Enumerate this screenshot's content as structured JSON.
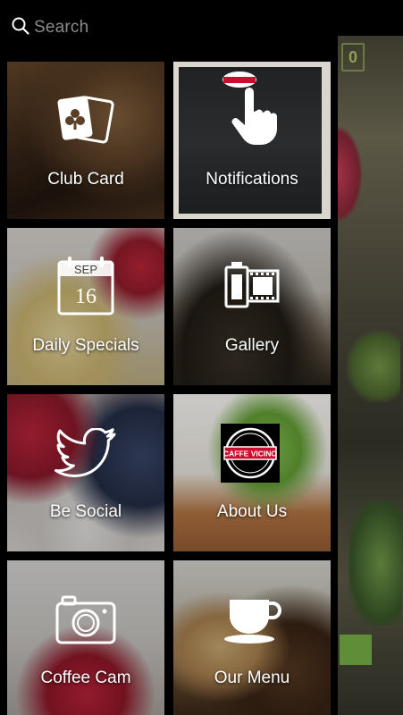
{
  "search": {
    "placeholder": "Search",
    "icon": "search-icon"
  },
  "underlying": {
    "badge": "0"
  },
  "logo_text": "CAFFE VICINO",
  "tiles": [
    {
      "label": "Club Card",
      "icon": "playing-cards-icon"
    },
    {
      "label": "Notifications",
      "icon": "pointing-hand-icon"
    },
    {
      "label": "Daily Specials",
      "icon": "calendar-icon",
      "calendar": {
        "month": "SEP",
        "day": "16"
      }
    },
    {
      "label": "Gallery",
      "icon": "film-roll-icon"
    },
    {
      "label": "Be Social",
      "icon": "twitter-bird-icon"
    },
    {
      "label": "About Us",
      "icon": "caffe-vicino-logo"
    },
    {
      "label": "Coffee Cam",
      "icon": "camera-icon"
    },
    {
      "label": "Our Menu",
      "icon": "coffee-cup-icon"
    }
  ],
  "colors": {
    "background": "#000000",
    "logo_red": "#c8102e",
    "search_text": "#8a8a8a"
  }
}
